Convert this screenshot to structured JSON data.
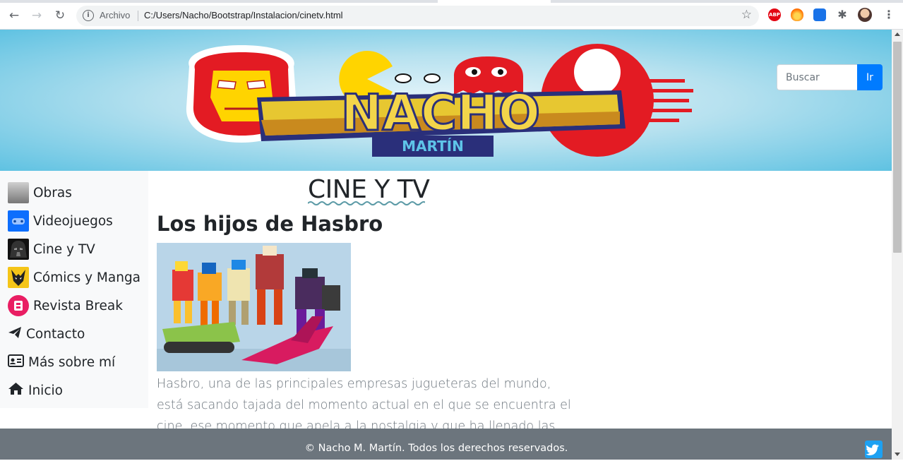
{
  "browser": {
    "scheme_label": "Archivo",
    "url": "C:/Users/Nacho/Bootstrap/Instalacion/cinetv.html",
    "extensions": [
      "abp-icon",
      "fire-icon",
      "monitor-icon",
      "puzzle-icon",
      "profile-avatar",
      "menu-icon"
    ],
    "abp_label": "ABP"
  },
  "header": {
    "logo_title": "NACHO",
    "logo_subtitle": "MARTÍN",
    "search_placeholder": "Buscar",
    "search_button": "Ir"
  },
  "sidebar": {
    "items": [
      {
        "label": "Obras",
        "icon": "obras-thumbnail"
      },
      {
        "label": "Videojuegos",
        "icon": "gamepad-thumbnail"
      },
      {
        "label": "Cine y TV",
        "icon": "darth-vader-thumbnail"
      },
      {
        "label": "Cómics y Manga",
        "icon": "wolverine-thumbnail"
      },
      {
        "label": "Revista Break",
        "icon": "break-logo-thumbnail"
      },
      {
        "label": "Contacto",
        "icon": "paper-plane-icon"
      },
      {
        "label": "Más sobre mí",
        "icon": "id-card-icon"
      },
      {
        "label": "Inicio",
        "icon": "home-icon"
      }
    ]
  },
  "main": {
    "page_title": "CINE Y TV",
    "article_title": "Los hijos de Hasbro",
    "article_text": "Hasbro, una de las principales empresas jugueteras del mundo, está sacando tajada del momento actual en el que se encuentra el cine, ese momento que apela a la nostalgia y que ha llenado las pantallas de"
  },
  "footer": {
    "copyright": "© Nacho M. Martín. Todos los derechos reservados."
  },
  "colors": {
    "primary": "#007bff",
    "footer_bg": "#6c757d",
    "sidebar_bg": "#f8f9fa",
    "banner_blue": "#5fc2e2"
  }
}
